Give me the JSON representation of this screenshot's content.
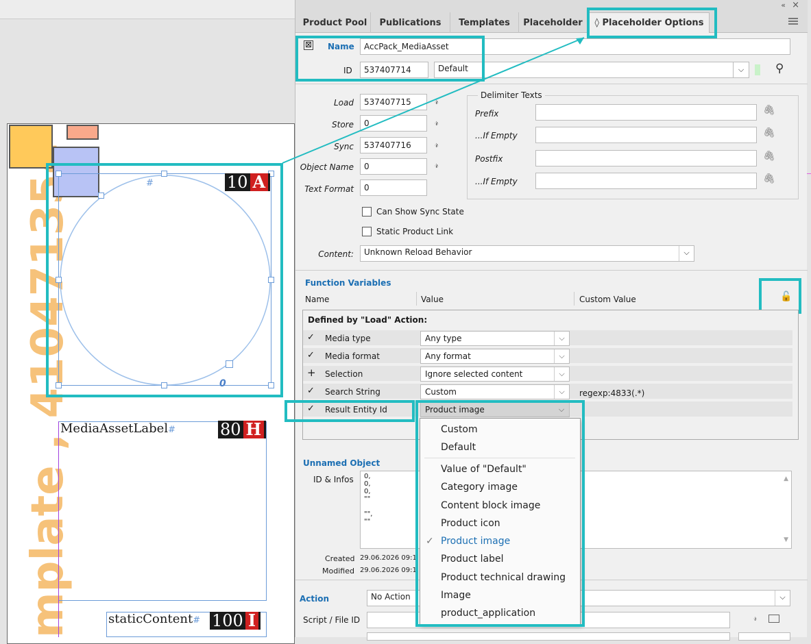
{
  "tabs": [
    "Product Pool",
    "Publications",
    "Templates",
    "Placeholder",
    "◊ Placeholder Options"
  ],
  "window_controls": [
    "«",
    "×"
  ],
  "menu_icon": "hamburger-icon",
  "name_label": "Name",
  "name_value": "AccPack_MediaAsset",
  "id_label": "ID",
  "id_value": "537407714",
  "id_type": "Default",
  "fields": {
    "load_label": "Load",
    "load_value": "537407715",
    "store_label": "Store",
    "store_value": "0",
    "sync_label": "Sync",
    "sync_value": "537407716",
    "object_name_label": "Object Name",
    "object_name_value": "0",
    "text_format_label": "Text Format",
    "text_format_value": "0"
  },
  "delimiter": {
    "title": "Delimiter Texts",
    "prefix": "Prefix",
    "if_empty_1": "...If Empty",
    "postfix": "Postfix",
    "if_empty_2": "...If Empty"
  },
  "checkboxes": {
    "sync_state": "Can Show Sync State",
    "static_link": "Static Product Link"
  },
  "content_label": "Content:",
  "content_value": "Unknown Reload Behavior",
  "function_variables": {
    "title": "Function Variables",
    "col_name": "Name",
    "col_value": "Value",
    "col_custom": "Custom Value",
    "group": "Defined by \"Load\" Action:",
    "rows": [
      {
        "mark": "✓",
        "name": "Media type",
        "value": "Any type",
        "custom": ""
      },
      {
        "mark": "✓",
        "name": "Media format",
        "value": "Any format",
        "custom": ""
      },
      {
        "mark": "+",
        "name": "Selection",
        "value": "Ignore selected content",
        "custom": ""
      },
      {
        "mark": "✓",
        "name": "Search String",
        "value": "Custom",
        "custom": "regexp:4833(.*)"
      },
      {
        "mark": "✓",
        "name": "Result Entity Id",
        "value": "Product image",
        "custom": ""
      }
    ]
  },
  "unnamed_object": {
    "title": "Unnamed Object",
    "id_infos_label": "ID & Infos",
    "id_infos_lines": [
      "0,",
      "0,",
      "0,",
      "\"\"",
      "",
      "\"\",",
      "\"\""
    ],
    "created_label": "Created",
    "created_value": "29.06.2026 09:1",
    "modified_label": "Modified",
    "modified_value": "29.06.2026 09:1"
  },
  "action_label": "Action",
  "action_value": "No Action",
  "script_label": "Script / File ID",
  "dropdown_options": [
    "Custom",
    "Default",
    "Value of \"Default\"",
    "Category image",
    "Content block image",
    "Product icon",
    "Product image",
    "Product label",
    "Product technical drawing",
    "Image",
    "product_application"
  ],
  "dropdown_selected": "Product image",
  "canvas": {
    "watermark": "mplate , 410471354",
    "frame1_tag_num": "10",
    "frame1_tag_letter": "A",
    "frame2_label": "MediaAssetLabel",
    "frame2_hash": "#",
    "frame2_tag_num": "80",
    "frame2_tag_letter": "H",
    "frame3_label": "staticContent",
    "frame3_hash": "#",
    "frame3_tag_num": "100",
    "frame3_tag_letter": "I",
    "hash": "#",
    "zero": "0"
  },
  "colors": {
    "teal_highlight": "#22bcc1",
    "link_blue": "#1c6fb3",
    "tag_red": "#d02020",
    "watermark": "#f6c27a"
  }
}
